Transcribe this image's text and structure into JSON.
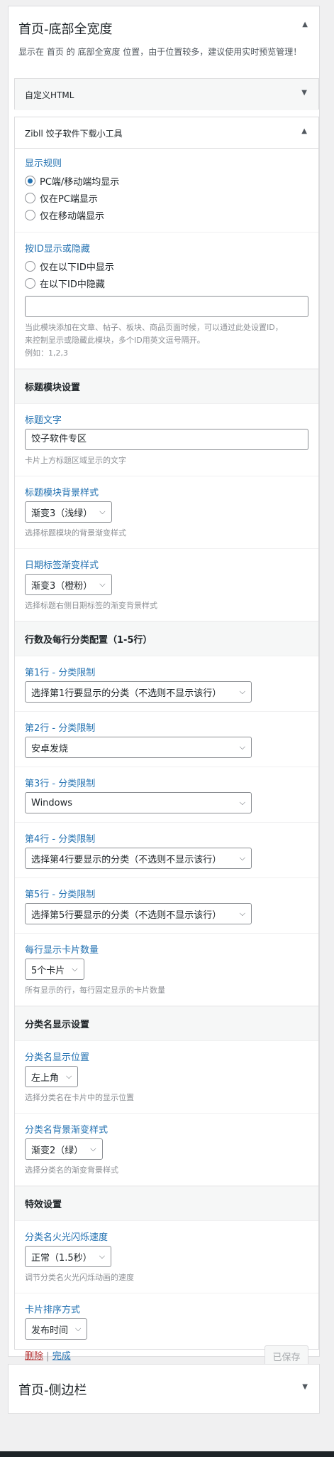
{
  "area_home_bottom": {
    "title": "首页-底部全宽度",
    "description": "显示在 首页 的 底部全宽度 位置，由于位置较多，建议使用实时预览管理！"
  },
  "widget_custom_html": {
    "title": "自定义HTML"
  },
  "widget_zibll": {
    "title": "Zibll 饺子软件下载小工具",
    "display_rule": {
      "label": "显示规则",
      "options": [
        "PC端/移动端均显示",
        "仅在PC端显示",
        "仅在移动端显示"
      ],
      "selected": "PC端/移动端均显示"
    },
    "id_visibility": {
      "label": "按ID显示或隐藏",
      "options": [
        "仅在以下ID中显示",
        "在以下ID中隐藏"
      ],
      "value": "",
      "help1": "当此模块添加在文章、帖子、板块、商品页面时候，可以通过此处设置ID，",
      "help2": "来控制显示或隐藏此模块，多个ID用英文逗号隔开。",
      "help3": "例如：1,2,3"
    },
    "section_title": "标题模块设置",
    "title_text": {
      "label": "标题文字",
      "value": "饺子软件专区",
      "help": "卡片上方标题区域显示的文字"
    },
    "title_bg": {
      "label": "标题模块背景样式",
      "value": "渐变3（浅绿）",
      "help": "选择标题模块的背景渐变样式"
    },
    "date_bg": {
      "label": "日期标签渐变样式",
      "value": "渐变3（橙粉）",
      "help": "选择标题右侧日期标签的渐变背景样式"
    },
    "section_rows": "行数及每行分类配置（1-5行）",
    "rows": [
      {
        "label": "第1行 - 分类限制",
        "value": "选择第1行要显示的分类（不选则不显示该行）"
      },
      {
        "label": "第2行 - 分类限制",
        "value": "安卓发烧"
      },
      {
        "label": "第3行 - 分类限制",
        "value": "Windows"
      },
      {
        "label": "第4行 - 分类限制",
        "value": "选择第4行要显示的分类（不选则不显示该行）"
      },
      {
        "label": "第5行 - 分类限制",
        "value": "选择第5行要显示的分类（不选则不显示该行）"
      }
    ],
    "cards_per_row": {
      "label": "每行显示卡片数量",
      "value": "5个卡片",
      "help": "所有显示的行，每行固定显示的卡片数量"
    },
    "section_catname": "分类名显示设置",
    "catname_pos": {
      "label": "分类名显示位置",
      "value": "左上角",
      "help": "选择分类名在卡片中的显示位置"
    },
    "catname_bg": {
      "label": "分类名背景渐变样式",
      "value": "渐变2（绿）",
      "help": "选择分类名的渐变背景样式"
    },
    "section_effects": "特效设置",
    "flash_speed": {
      "label": "分类名火光闪烁速度",
      "value": "正常（1.5秒）",
      "help": "调节分类名火光闪烁动画的速度"
    },
    "sort": {
      "label": "卡片排序方式",
      "value": "发布时间"
    },
    "footer": {
      "delete": "删除",
      "sep": "|",
      "done": "完成",
      "save": "已保存"
    }
  },
  "area_home_sidebar": {
    "title": "首页-侧边栏"
  }
}
